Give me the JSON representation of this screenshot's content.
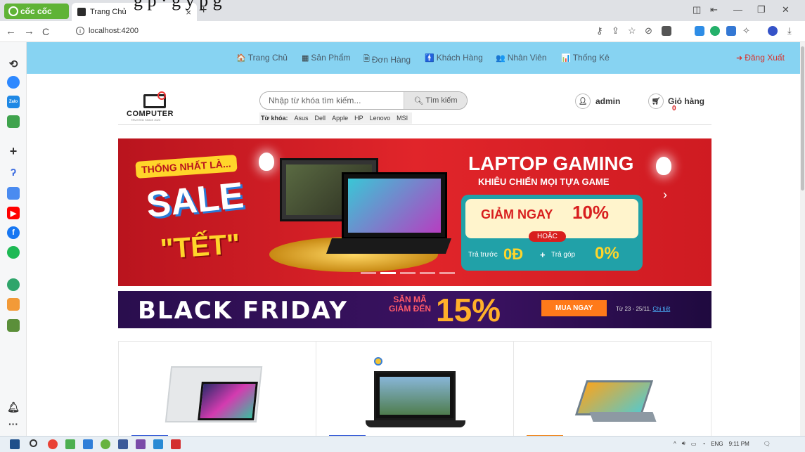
{
  "top_caption": "g   p  ·   g        y     p          g",
  "browser": {
    "coccoc_label": "cốc cốc",
    "tab_title": "Trang Chủ",
    "tab_close": "×",
    "new_tab": "+",
    "url": "localhost:4200",
    "nav_back": "←",
    "nav_forward": "→",
    "nav_reload": "C"
  },
  "site": {
    "nav": [
      {
        "label": "Trang Chủ",
        "icon": "home-icon",
        "glyph": "🏠"
      },
      {
        "label": "Sản Phẩm",
        "icon": "grid-icon",
        "glyph": "▦"
      },
      {
        "label": "Đơn Hàng",
        "icon": "document-icon",
        "glyph": "🗎"
      },
      {
        "label": "Khách Hàng",
        "icon": "person-icon",
        "glyph": "🚹"
      },
      {
        "label": "Nhân Viên",
        "icon": "users-icon",
        "glyph": "👥"
      },
      {
        "label": "Thống Kê",
        "icon": "bar-chart-icon",
        "glyph": "📊"
      }
    ],
    "logout": "Đăng Xuất",
    "logo_text": "COMPUTER",
    "logo_sub": "TRUSTED SINCE 2020",
    "search_placeholder": "Nhập từ khóa tìm kiếm...",
    "search_button": "Tìm kiếm",
    "keywords_label": "Từ khóa:",
    "keywords": [
      "Asus",
      "Dell",
      "Apple",
      "HP",
      "Lenovo",
      "MSI"
    ],
    "user_name": "admin",
    "cart_label": "Giỏ hàng",
    "cart_count": "0"
  },
  "hero": {
    "tag": "THỐNG NHẤT LÀ...",
    "sale": "SALE",
    "tet": "\"TẾT\"",
    "title": "LAPTOP GAMING",
    "subtitle": "KHIÊU CHIẾN MỌI TỰA GAME",
    "discount_text": "GIẢM NGAY",
    "discount_value": "10%",
    "or": "HOẶC",
    "prepay": "Trả trước",
    "prepay_value": "0Đ",
    "plus": "+",
    "installment": "Trả góp",
    "installment_value": "0%",
    "slide_count": 5,
    "active_slide": 1
  },
  "black_friday": {
    "title": "BLACK FRIDAY",
    "code_line1": "SĂN MÃ",
    "code_line2": "GIẢM ĐẾN",
    "percent": "15%",
    "cta": "MUA NGAY",
    "dates": "Từ 23 - 25/11.",
    "details_link": "Chi tiết"
  },
  "colors": {
    "nav_bg": "#87d3f2",
    "hero_red": "#e1252a",
    "bf_purple": "#2a0e4e",
    "logout": "#d8322c"
  },
  "taskbar": {
    "lang": "ENG",
    "time": "9:11 PM"
  }
}
